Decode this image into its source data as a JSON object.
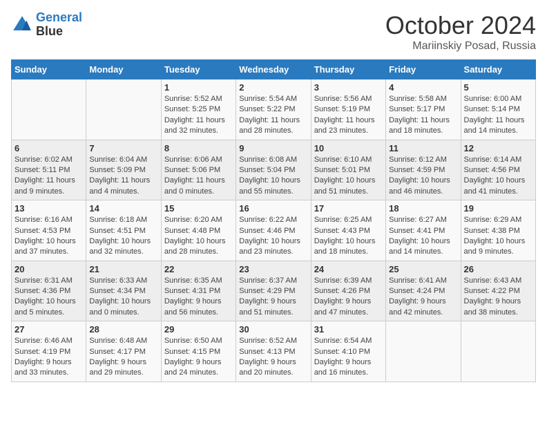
{
  "header": {
    "logo_line1": "General",
    "logo_line2": "Blue",
    "month": "October 2024",
    "location": "Mariinskiy Posad, Russia"
  },
  "weekdays": [
    "Sunday",
    "Monday",
    "Tuesday",
    "Wednesday",
    "Thursday",
    "Friday",
    "Saturday"
  ],
  "weeks": [
    [
      {
        "day": "",
        "sunrise": "",
        "sunset": "",
        "daylight": ""
      },
      {
        "day": "",
        "sunrise": "",
        "sunset": "",
        "daylight": ""
      },
      {
        "day": "1",
        "sunrise": "Sunrise: 5:52 AM",
        "sunset": "Sunset: 5:25 PM",
        "daylight": "Daylight: 11 hours and 32 minutes."
      },
      {
        "day": "2",
        "sunrise": "Sunrise: 5:54 AM",
        "sunset": "Sunset: 5:22 PM",
        "daylight": "Daylight: 11 hours and 28 minutes."
      },
      {
        "day": "3",
        "sunrise": "Sunrise: 5:56 AM",
        "sunset": "Sunset: 5:19 PM",
        "daylight": "Daylight: 11 hours and 23 minutes."
      },
      {
        "day": "4",
        "sunrise": "Sunrise: 5:58 AM",
        "sunset": "Sunset: 5:17 PM",
        "daylight": "Daylight: 11 hours and 18 minutes."
      },
      {
        "day": "5",
        "sunrise": "Sunrise: 6:00 AM",
        "sunset": "Sunset: 5:14 PM",
        "daylight": "Daylight: 11 hours and 14 minutes."
      }
    ],
    [
      {
        "day": "6",
        "sunrise": "Sunrise: 6:02 AM",
        "sunset": "Sunset: 5:11 PM",
        "daylight": "Daylight: 11 hours and 9 minutes."
      },
      {
        "day": "7",
        "sunrise": "Sunrise: 6:04 AM",
        "sunset": "Sunset: 5:09 PM",
        "daylight": "Daylight: 11 hours and 4 minutes."
      },
      {
        "day": "8",
        "sunrise": "Sunrise: 6:06 AM",
        "sunset": "Sunset: 5:06 PM",
        "daylight": "Daylight: 11 hours and 0 minutes."
      },
      {
        "day": "9",
        "sunrise": "Sunrise: 6:08 AM",
        "sunset": "Sunset: 5:04 PM",
        "daylight": "Daylight: 10 hours and 55 minutes."
      },
      {
        "day": "10",
        "sunrise": "Sunrise: 6:10 AM",
        "sunset": "Sunset: 5:01 PM",
        "daylight": "Daylight: 10 hours and 51 minutes."
      },
      {
        "day": "11",
        "sunrise": "Sunrise: 6:12 AM",
        "sunset": "Sunset: 4:59 PM",
        "daylight": "Daylight: 10 hours and 46 minutes."
      },
      {
        "day": "12",
        "sunrise": "Sunrise: 6:14 AM",
        "sunset": "Sunset: 4:56 PM",
        "daylight": "Daylight: 10 hours and 41 minutes."
      }
    ],
    [
      {
        "day": "13",
        "sunrise": "Sunrise: 6:16 AM",
        "sunset": "Sunset: 4:53 PM",
        "daylight": "Daylight: 10 hours and 37 minutes."
      },
      {
        "day": "14",
        "sunrise": "Sunrise: 6:18 AM",
        "sunset": "Sunset: 4:51 PM",
        "daylight": "Daylight: 10 hours and 32 minutes."
      },
      {
        "day": "15",
        "sunrise": "Sunrise: 6:20 AM",
        "sunset": "Sunset: 4:48 PM",
        "daylight": "Daylight: 10 hours and 28 minutes."
      },
      {
        "day": "16",
        "sunrise": "Sunrise: 6:22 AM",
        "sunset": "Sunset: 4:46 PM",
        "daylight": "Daylight: 10 hours and 23 minutes."
      },
      {
        "day": "17",
        "sunrise": "Sunrise: 6:25 AM",
        "sunset": "Sunset: 4:43 PM",
        "daylight": "Daylight: 10 hours and 18 minutes."
      },
      {
        "day": "18",
        "sunrise": "Sunrise: 6:27 AM",
        "sunset": "Sunset: 4:41 PM",
        "daylight": "Daylight: 10 hours and 14 minutes."
      },
      {
        "day": "19",
        "sunrise": "Sunrise: 6:29 AM",
        "sunset": "Sunset: 4:38 PM",
        "daylight": "Daylight: 10 hours and 9 minutes."
      }
    ],
    [
      {
        "day": "20",
        "sunrise": "Sunrise: 6:31 AM",
        "sunset": "Sunset: 4:36 PM",
        "daylight": "Daylight: 10 hours and 5 minutes."
      },
      {
        "day": "21",
        "sunrise": "Sunrise: 6:33 AM",
        "sunset": "Sunset: 4:34 PM",
        "daylight": "Daylight: 10 hours and 0 minutes."
      },
      {
        "day": "22",
        "sunrise": "Sunrise: 6:35 AM",
        "sunset": "Sunset: 4:31 PM",
        "daylight": "Daylight: 9 hours and 56 minutes."
      },
      {
        "day": "23",
        "sunrise": "Sunrise: 6:37 AM",
        "sunset": "Sunset: 4:29 PM",
        "daylight": "Daylight: 9 hours and 51 minutes."
      },
      {
        "day": "24",
        "sunrise": "Sunrise: 6:39 AM",
        "sunset": "Sunset: 4:26 PM",
        "daylight": "Daylight: 9 hours and 47 minutes."
      },
      {
        "day": "25",
        "sunrise": "Sunrise: 6:41 AM",
        "sunset": "Sunset: 4:24 PM",
        "daylight": "Daylight: 9 hours and 42 minutes."
      },
      {
        "day": "26",
        "sunrise": "Sunrise: 6:43 AM",
        "sunset": "Sunset: 4:22 PM",
        "daylight": "Daylight: 9 hours and 38 minutes."
      }
    ],
    [
      {
        "day": "27",
        "sunrise": "Sunrise: 6:46 AM",
        "sunset": "Sunset: 4:19 PM",
        "daylight": "Daylight: 9 hours and 33 minutes."
      },
      {
        "day": "28",
        "sunrise": "Sunrise: 6:48 AM",
        "sunset": "Sunset: 4:17 PM",
        "daylight": "Daylight: 9 hours and 29 minutes."
      },
      {
        "day": "29",
        "sunrise": "Sunrise: 6:50 AM",
        "sunset": "Sunset: 4:15 PM",
        "daylight": "Daylight: 9 hours and 24 minutes."
      },
      {
        "day": "30",
        "sunrise": "Sunrise: 6:52 AM",
        "sunset": "Sunset: 4:13 PM",
        "daylight": "Daylight: 9 hours and 20 minutes."
      },
      {
        "day": "31",
        "sunrise": "Sunrise: 6:54 AM",
        "sunset": "Sunset: 4:10 PM",
        "daylight": "Daylight: 9 hours and 16 minutes."
      },
      {
        "day": "",
        "sunrise": "",
        "sunset": "",
        "daylight": ""
      },
      {
        "day": "",
        "sunrise": "",
        "sunset": "",
        "daylight": ""
      }
    ]
  ]
}
